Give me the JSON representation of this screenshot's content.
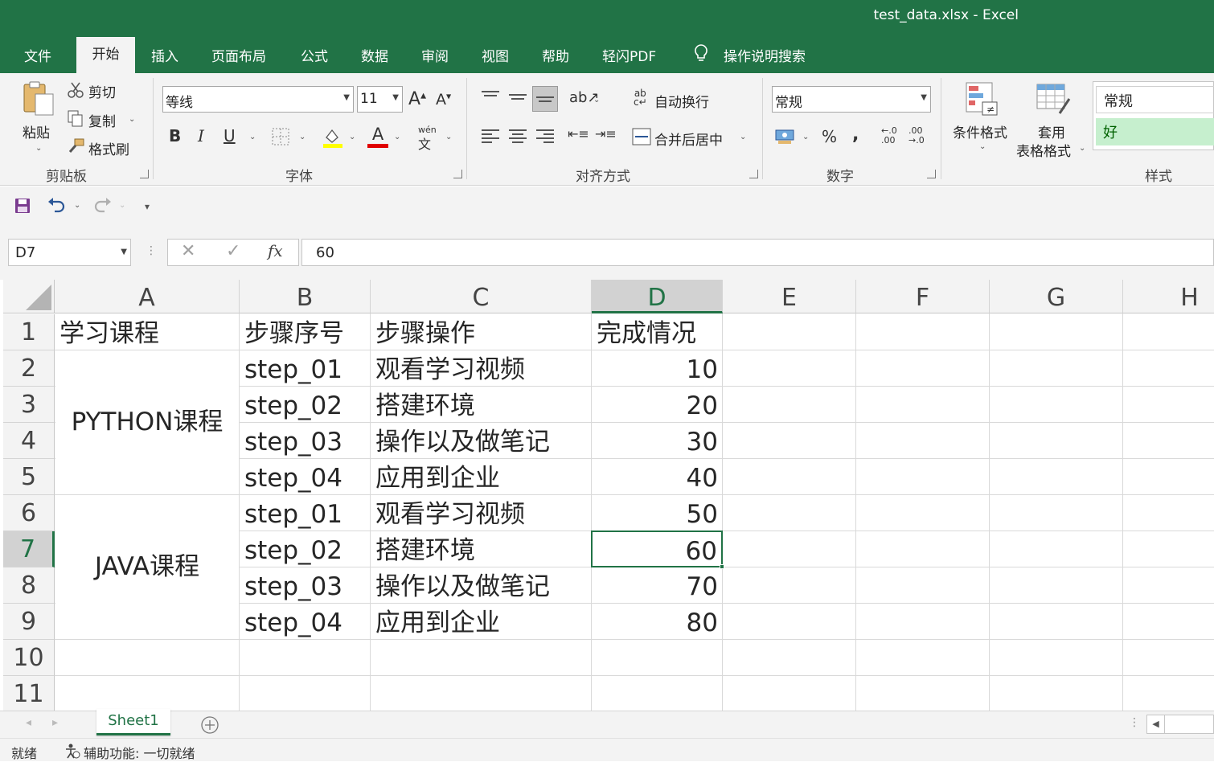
{
  "window": {
    "title": "test_data.xlsx  -  Excel"
  },
  "menu": {
    "tabs": [
      "文件",
      "开始",
      "插入",
      "页面布局",
      "公式",
      "数据",
      "审阅",
      "视图",
      "帮助",
      "轻闪PDF"
    ],
    "tell_me": "操作说明搜索"
  },
  "ribbon": {
    "clipboard": {
      "paste": "粘贴",
      "cut": "剪切",
      "copy": "复制",
      "format_painter": "格式刷",
      "group_label": "剪贴板"
    },
    "font": {
      "font_name": "等线",
      "font_size": "11",
      "bold": "B",
      "italic": "I",
      "underline": "U",
      "phonetic": "wén",
      "group_label": "字体"
    },
    "alignment": {
      "wrap_text": "自动换行",
      "merge_center": "合并后居中",
      "group_label": "对齐方式"
    },
    "number": {
      "format": "常规",
      "percent": "%",
      "comma": ",",
      "inc_decimal_top": "←.0",
      "inc_decimal_bottom": ".00",
      "dec_decimal_top": ".00",
      "dec_decimal_bottom": "→.0",
      "group_label": "数字"
    },
    "styles": {
      "conditional_formatting": "条件格式",
      "format_as_table_1": "套用",
      "format_as_table_2": "表格格式",
      "style_normal": "常规",
      "style_good": "好",
      "group_label": "样式"
    }
  },
  "formula_bar": {
    "name_box": "D7",
    "formula": "60",
    "fx": "fx"
  },
  "columns": [
    "A",
    "B",
    "C",
    "D",
    "E",
    "F",
    "G",
    "H"
  ],
  "rows": [
    "1",
    "2",
    "3",
    "4",
    "5",
    "6",
    "7",
    "8",
    "9",
    "10",
    "11"
  ],
  "cells": {
    "header": [
      "学习课程",
      "步骤序号",
      "步骤操作",
      "完成情况"
    ],
    "merged_a": [
      "PYTHON课程",
      "JAVA课程"
    ],
    "steps": [
      "step_01",
      "step_02",
      "step_03",
      "step_04",
      "step_01",
      "step_02",
      "step_03",
      "step_04"
    ],
    "operations": [
      "观看学习视频",
      "搭建环境",
      "操作以及做笔记",
      "应用到企业",
      "观看学习视频",
      "搭建环境",
      "操作以及做笔记",
      "应用到企业"
    ],
    "completion": [
      "10",
      "20",
      "30",
      "40",
      "50",
      "60",
      "70",
      "80"
    ]
  },
  "sheets": {
    "active": "Sheet1"
  },
  "status": {
    "ready": "就绪",
    "accessibility": "辅助功能: 一切就绪"
  },
  "colors": {
    "brand": "#217346",
    "ribbon_bg": "#f3f3f3",
    "good_style_bg": "#c6efce",
    "good_style_text": "#006100"
  }
}
